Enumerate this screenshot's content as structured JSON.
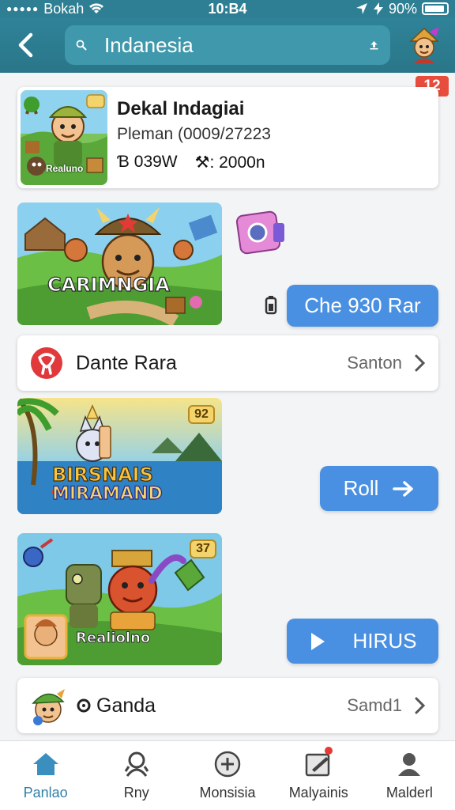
{
  "status": {
    "carrier": "Bokah",
    "time": "10:B4",
    "battery": "90%"
  },
  "header": {
    "search_value": "Indanesia"
  },
  "notification_count": "12",
  "featured": {
    "title": "Dekal Indagiai",
    "meta": "Pleman (0009/27223",
    "stat1": "Ɓ 039W",
    "stat2": "⚒: 2000n",
    "thumb_label": "Realuno"
  },
  "game1": {
    "art_title": "CARIMNGIA",
    "button": "Che 930 Rar"
  },
  "row1": {
    "name": "Dante Rara",
    "right": "Santon"
  },
  "game2": {
    "level": "92",
    "art_title_1": "BIRSNAIS",
    "art_title_2": "MIRAMAND",
    "button": "Roll"
  },
  "game3": {
    "level": "37",
    "art_label": "Realiolno",
    "button": "HIRUS"
  },
  "row2": {
    "name": "Ganda",
    "right": "Samd1"
  },
  "nav": [
    {
      "label": "Panlao"
    },
    {
      "label": "Rny"
    },
    {
      "label": "Monsisia"
    },
    {
      "label": "Malyainis"
    },
    {
      "label": "Malderl"
    }
  ],
  "colors": {
    "header": "#2e7f93",
    "accent_blue": "#4a90e2",
    "badge_red": "#e74c3c"
  }
}
